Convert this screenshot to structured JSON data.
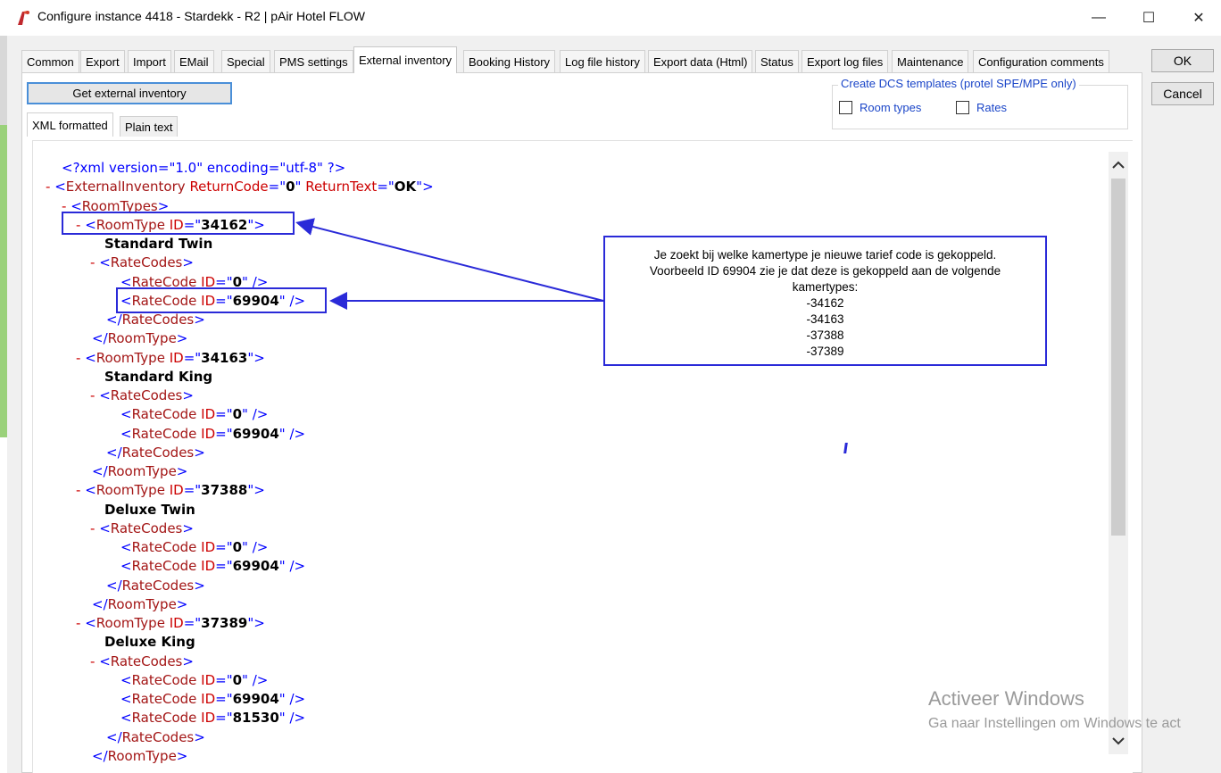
{
  "window": {
    "title": "Configure instance 4418 - Stardekk - R2 | pAir Hotel FLOW",
    "minimize": "—",
    "maximize": "☐",
    "close": "✕"
  },
  "tabs": [
    {
      "label": "Common"
    },
    {
      "label": "Export"
    },
    {
      "label": "Import"
    },
    {
      "label": "EMail"
    },
    {
      "label": "Special"
    },
    {
      "label": "PMS settings"
    },
    {
      "label": "External inventory"
    },
    {
      "label": "Booking History"
    },
    {
      "label": "Log file history"
    },
    {
      "label": "Export data (Html)"
    },
    {
      "label": "Status"
    },
    {
      "label": "Export log files"
    },
    {
      "label": "Maintenance"
    },
    {
      "label": "Configuration comments"
    }
  ],
  "active_tab": "External inventory",
  "buttons": {
    "ok": "OK",
    "cancel": "Cancel",
    "get_inventory": "Get external inventory"
  },
  "dcs": {
    "legend": "Create DCS templates (protel SPE/MPE only)",
    "room_types": "Room types",
    "rates": "Rates",
    "room_types_checked": false,
    "rates_checked": false
  },
  "subtabs": [
    {
      "label": "XML formatted"
    },
    {
      "label": "Plain text"
    }
  ],
  "xml": {
    "declaration": "<?xml version=\"1.0\" encoding=\"utf-8\" ?>",
    "collapse_marker": "-",
    "root_tag": "ExternalInventory",
    "attr_returncode": "ReturnCode",
    "returncode": "0",
    "attr_returntext": "ReturnText",
    "returntext": "OK",
    "roomtypes_tag": "RoomTypes",
    "roomtype_tag": "RoomType",
    "ratecodes_tag": "RateCodes",
    "ratecode_tag": "RateCode",
    "id_attr": "ID",
    "room_types": [
      {
        "id": "34162",
        "name": "Standard Twin",
        "rates": [
          "0",
          "69904"
        ]
      },
      {
        "id": "34163",
        "name": "Standard King",
        "rates": [
          "0",
          "69904"
        ]
      },
      {
        "id": "37388",
        "name": "Deluxe Twin",
        "rates": [
          "0",
          "69904"
        ]
      },
      {
        "id": "37389",
        "name": "Deluxe King",
        "rates": [
          "0",
          "69904",
          "81530"
        ]
      }
    ]
  },
  "annotation": {
    "lines": [
      "Je zoekt bij welke kamertype je nieuwe tarief code is gekoppeld.",
      "Voorbeeld ID 69904 zie je dat deze is gekoppeld aan de volgende",
      "kamertypes:",
      "-34162",
      "-34163",
      "-37388",
      "-37389"
    ],
    "color": "#2a2ad8"
  },
  "watermark": {
    "line1": "Activeer Windows",
    "line2": "Ga naar Instellingen om Windows te act"
  }
}
